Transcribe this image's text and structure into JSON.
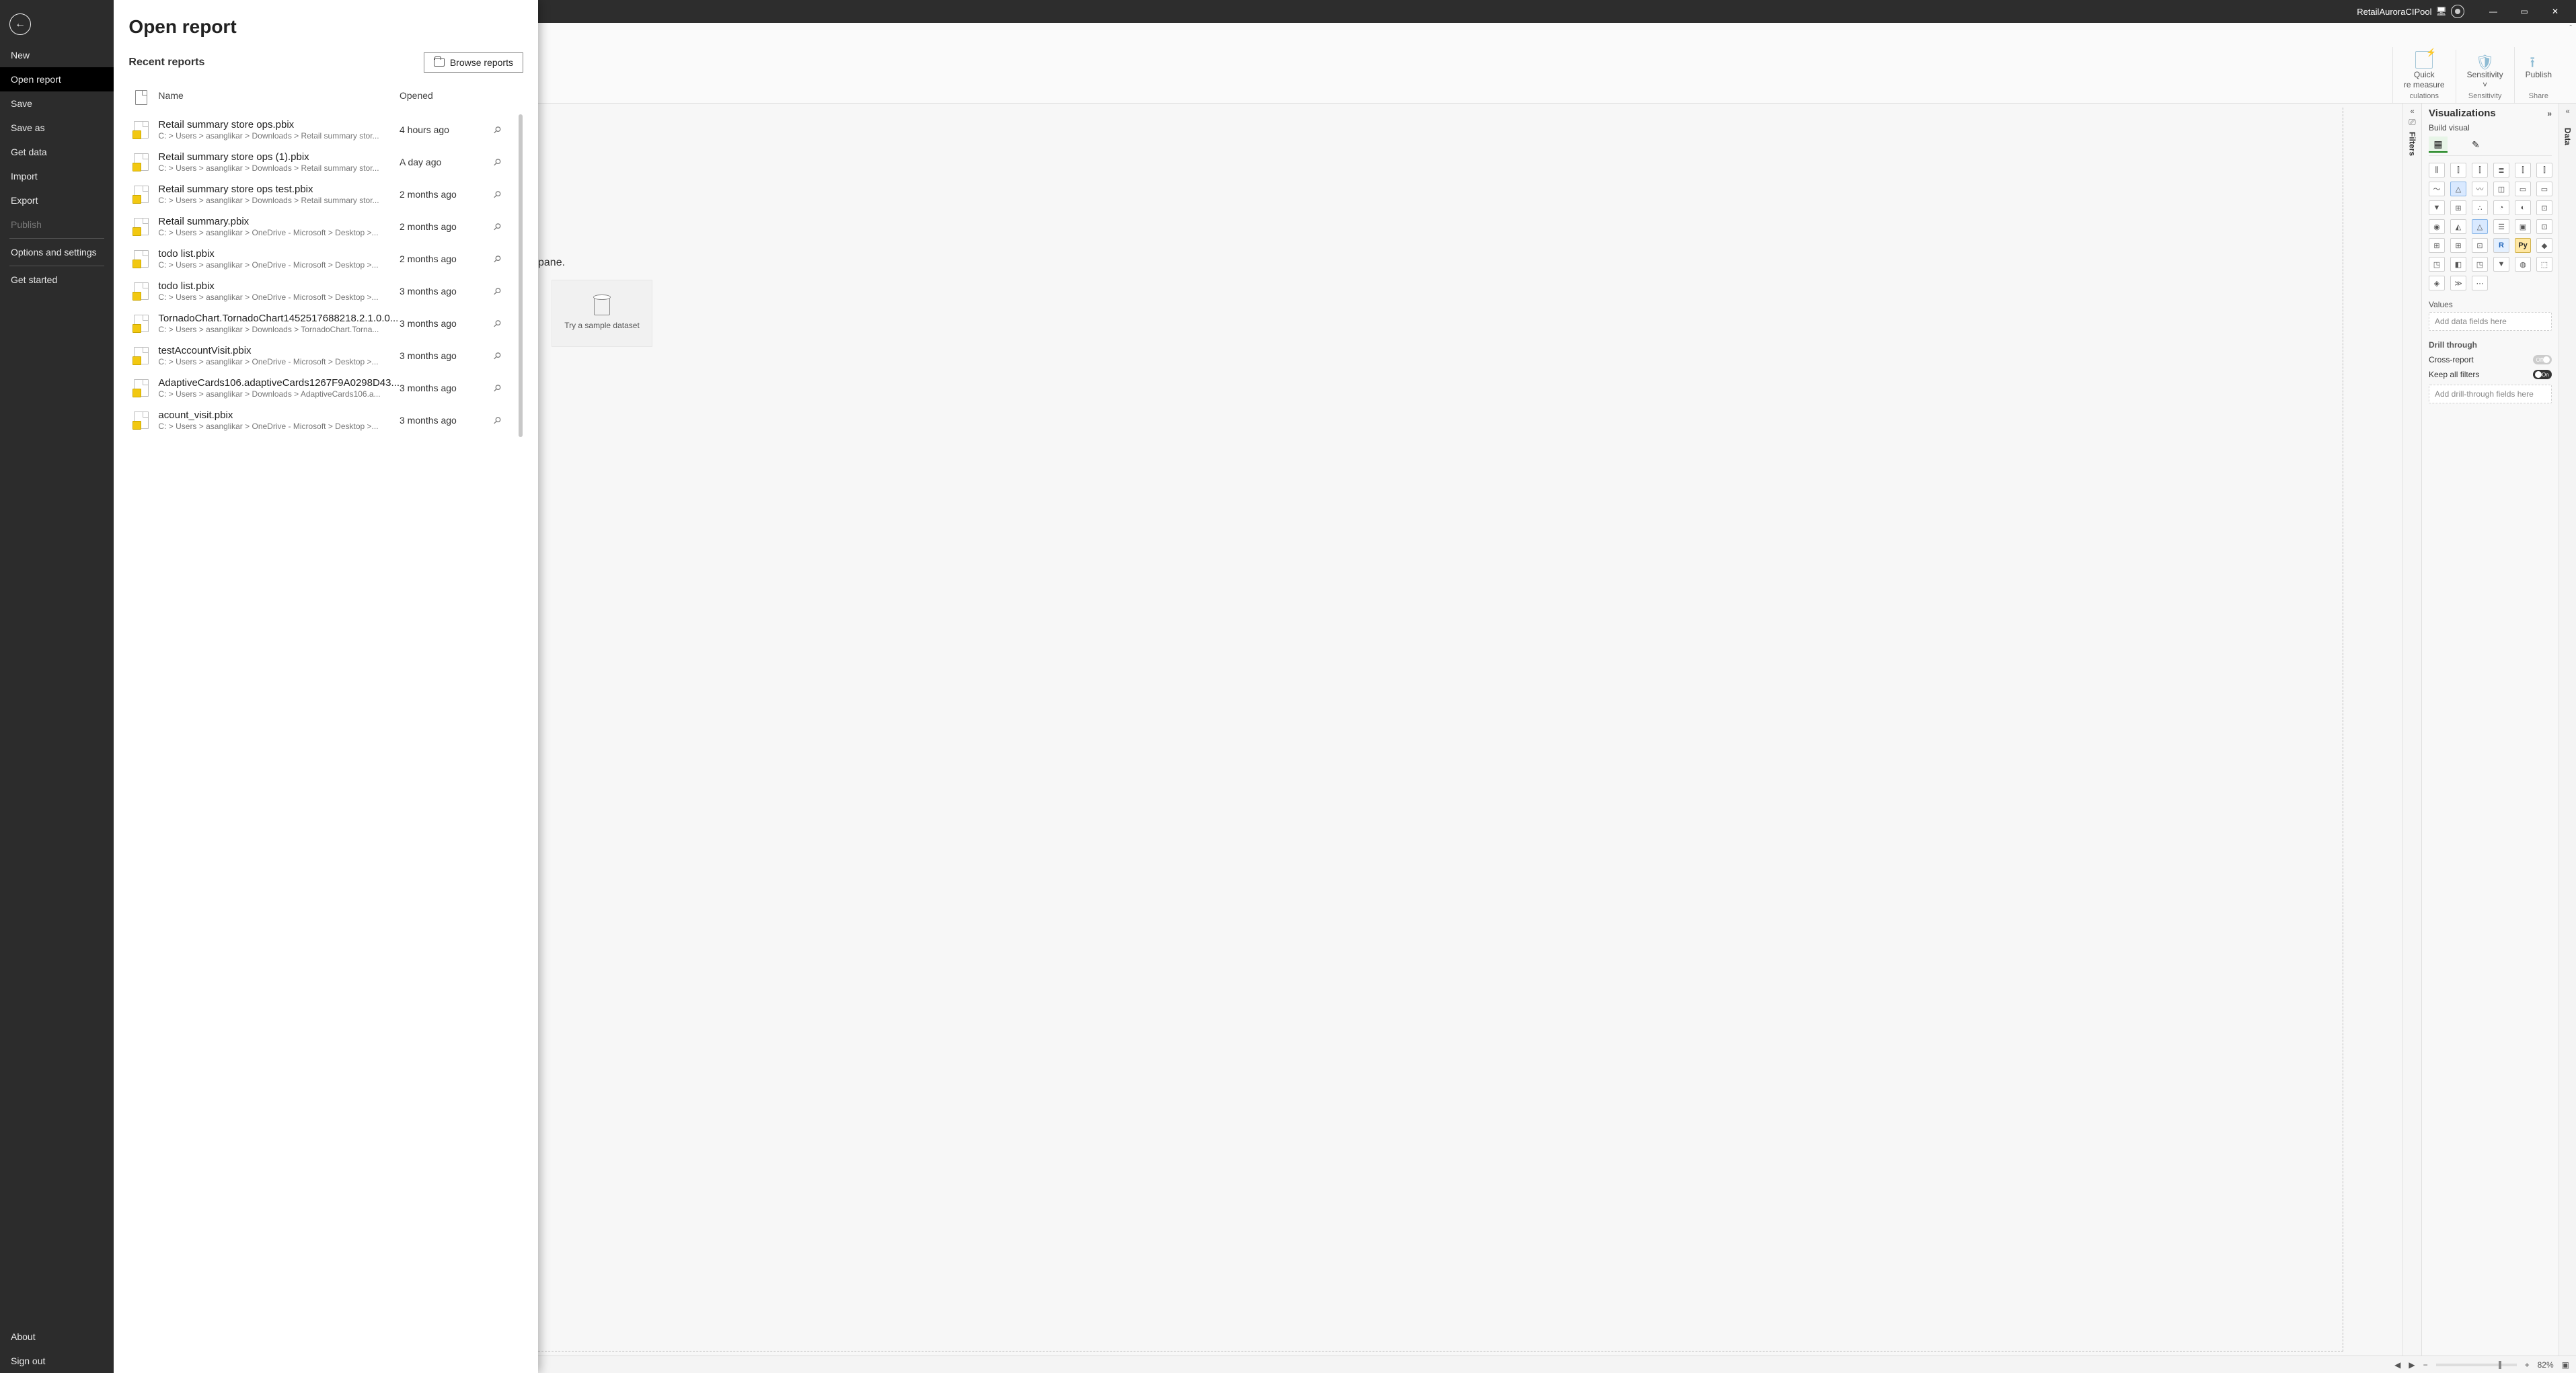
{
  "titlebar": {
    "account_name": "RetailAuroraCIPool"
  },
  "ribbon": {
    "quick_label": "Quick",
    "quick_sub": "re measure",
    "sensitivity_label": "Sensitivity",
    "publish_label": "Publish",
    "group_calc": "culations",
    "group_sens": "Sensitivity",
    "group_share": "Share"
  },
  "canvas": {
    "hint_suffix": "pane.",
    "sample_label": "Try a sample dataset"
  },
  "viz": {
    "title": "Visualizations",
    "subtitle": "Build visual",
    "values_label": "Values",
    "values_placeholder": "Add data fields here",
    "drill_label": "Drill through",
    "cross_label": "Cross-report",
    "cross_state": "Off",
    "keep_label": "Keep all filters",
    "keep_state": "On",
    "drill_placeholder": "Add drill-through fields here",
    "chips": [
      "⫼",
      "⫿",
      "⫿",
      "≣",
      "⫿",
      "⫿",
      "〜",
      "△",
      "〰",
      "◫",
      "▭",
      "▭",
      "▼",
      "⊞",
      "∴",
      "◔",
      "◐",
      "⊡",
      "◉",
      "◭",
      "△",
      "☰",
      "▣",
      "⊡",
      "⊞",
      "⊞",
      "⊡",
      "R",
      "Py",
      "◆",
      "◳",
      "◧",
      "◳",
      "▼",
      "◍",
      "⬚",
      "◈",
      "≫",
      "⋯"
    ]
  },
  "filters_label": "Filters",
  "data_label": "Data",
  "status": {
    "zoom": "82%"
  },
  "backstage": {
    "title": "Open report",
    "recent_title": "Recent reports",
    "browse_label": "Browse reports",
    "col_name": "Name",
    "col_opened": "Opened",
    "menu": [
      {
        "label": "New",
        "key": "new"
      },
      {
        "label": "Open report",
        "key": "open",
        "selected": true
      },
      {
        "label": "Save",
        "key": "save"
      },
      {
        "label": "Save as",
        "key": "saveas"
      },
      {
        "label": "Get data",
        "key": "getdata"
      },
      {
        "label": "Import",
        "key": "import"
      },
      {
        "label": "Export",
        "key": "export"
      },
      {
        "label": "Publish",
        "key": "publish",
        "disabled": true
      },
      {
        "label": "Options and settings",
        "key": "options",
        "sep_before": true
      },
      {
        "label": "Get started",
        "key": "getstarted",
        "sep_before": true
      }
    ],
    "menu_bottom": [
      {
        "label": "About",
        "key": "about"
      },
      {
        "label": "Sign out",
        "key": "signout"
      }
    ],
    "recent": [
      {
        "name": "Retail summary store ops.pbix",
        "path": "C: > Users > asanglikar > Downloads > Retail summary stor...",
        "opened": "4 hours ago"
      },
      {
        "name": "Retail summary store ops (1).pbix",
        "path": "C: > Users > asanglikar > Downloads > Retail summary stor...",
        "opened": "A day ago"
      },
      {
        "name": "Retail summary store ops test.pbix",
        "path": "C: > Users > asanglikar > Downloads > Retail summary stor...",
        "opened": "2 months ago"
      },
      {
        "name": "Retail summary.pbix",
        "path": "C: > Users > asanglikar > OneDrive - Microsoft > Desktop >...",
        "opened": "2 months ago"
      },
      {
        "name": "todo list.pbix",
        "path": "C: > Users > asanglikar > OneDrive - Microsoft > Desktop >...",
        "opened": "2 months ago"
      },
      {
        "name": "todo list.pbix",
        "path": "C: > Users > asanglikar > OneDrive - Microsoft > Desktop >...",
        "opened": "3 months ago"
      },
      {
        "name": "TornadoChart.TornadoChart1452517688218.2.1.0.0...",
        "path": "C: > Users > asanglikar > Downloads > TornadoChart.Torna...",
        "opened": "3 months ago"
      },
      {
        "name": "testAccountVisit.pbix",
        "path": "C: > Users > asanglikar > OneDrive - Microsoft > Desktop >...",
        "opened": "3 months ago"
      },
      {
        "name": "AdaptiveCards106.adaptiveCards1267F9A0298D43...",
        "path": "C: > Users > asanglikar > Downloads > AdaptiveCards106.a...",
        "opened": "3 months ago"
      },
      {
        "name": "acount_visit.pbix",
        "path": "C: > Users > asanglikar > OneDrive - Microsoft > Desktop >...",
        "opened": "3 months ago"
      }
    ]
  }
}
